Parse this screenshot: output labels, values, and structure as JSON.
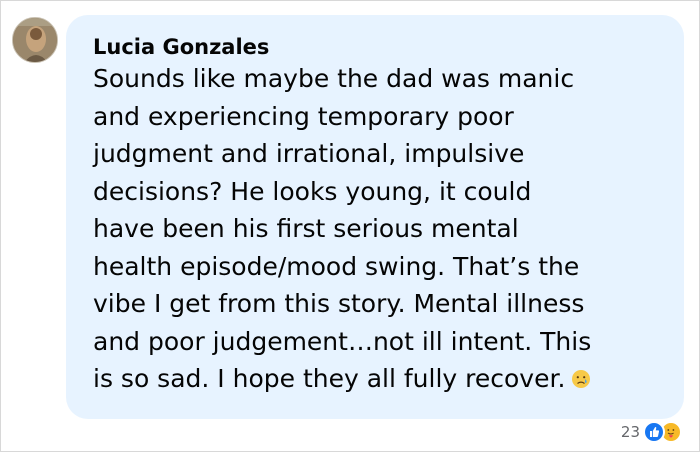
{
  "comment": {
    "author": "Lucia Gonzales",
    "lines": [
      "Sounds like maybe the dad was manic",
      "and experiencing temporary poor",
      "judgment and irrational, impulsive",
      "decisions? He looks young, it could",
      "have been his first serious mental",
      "health episode/mood swing. That’s the",
      "vibe I get from this story. Mental illness",
      "and poor judgement…not ill intent. This",
      "is so sad. I hope they all fully recover."
    ],
    "trailing_emoji": "crying-face-emoji"
  },
  "reactions": {
    "count": "23",
    "icons": [
      "like-icon",
      "care-icon"
    ],
    "colors": {
      "like": "#1877f2",
      "care": "#f7b928"
    }
  },
  "colors": {
    "bubble": "#e7f3ff",
    "text": "#050505",
    "meta": "#65676b"
  }
}
